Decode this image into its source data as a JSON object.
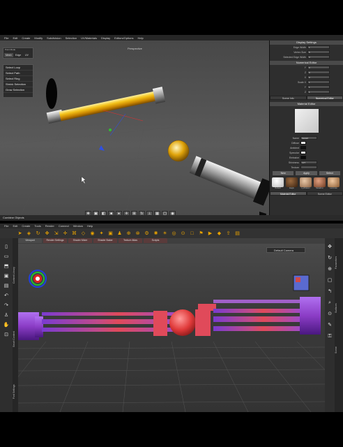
{
  "top_app": {
    "menu": [
      "File",
      "Edit",
      "Create",
      "Modify",
      "Subdivision",
      "Selection",
      "UV/Materials",
      "Display",
      "Editors/Options",
      "Help"
    ],
    "viewport_label": "Perspective",
    "selection_mode": {
      "title": "Point Mode",
      "buttons": [
        "Mesh",
        "Edge",
        "UV"
      ],
      "subtitle": "Surface View"
    },
    "selection_menu": [
      "Select Loop",
      "Select Path",
      "Select Ring",
      "Shrink Selection",
      "Grow Selection"
    ],
    "status": "Combine Objects",
    "display_settings": {
      "title": "Display Settings",
      "rows": [
        {
          "label": "Edge Width",
          "value": "1"
        },
        {
          "label": "Vertex Size",
          "value": "5"
        },
        {
          "label": "Selected Edge Width",
          "value": "3"
        }
      ]
    },
    "numerical_editor": {
      "title": "Numerical Editor",
      "rows": [
        {
          "label": "Y",
          "value": "0"
        },
        {
          "label": "Z",
          "value": "0"
        },
        {
          "label": "X",
          "value": "0"
        },
        {
          "label": "Scale X",
          "value": "1"
        },
        {
          "label": "Y",
          "value": "1"
        },
        {
          "label": "Z",
          "value": "1"
        }
      ],
      "tabs": [
        "Scene Info",
        "Numerical Editor"
      ]
    },
    "material_editor": {
      "title": "Material Editor",
      "name_label": "Name",
      "name_value": "Metal2",
      "properties": [
        {
          "label": "Diffuse",
          "color": "#f2f2f2"
        },
        {
          "label": "Ambient",
          "color": "#111111"
        },
        {
          "label": "Specular",
          "color": "#e0e0e0"
        },
        {
          "label": "Emissive",
          "color": "#0a0a0a"
        }
      ],
      "shininess_label": "Shininess",
      "shininess_value": "127",
      "texture_label": "Texture",
      "buttons": [
        "New",
        "Apply",
        "Select"
      ],
      "materials": [
        {
          "name": "Default",
          "color": "#f0f0f0"
        },
        {
          "name": "Eagle",
          "color": "#5a3a22"
        },
        {
          "name": "LynPattern",
          "color": "#c9a07a"
        },
        {
          "name": "Metal/Lio",
          "color": "#b57a52"
        },
        {
          "name": "Laminate",
          "color": "#d2a27a"
        }
      ],
      "tabs": [
        "Material Editor",
        "Scene Editor"
      ]
    }
  },
  "bottom_app": {
    "menu": [
      "File",
      "Edit",
      "Create",
      "Tools",
      "Render",
      "Connect",
      "Window",
      "Help"
    ],
    "tabs": [
      "Viewport",
      "Render Settings",
      "Shader Mixer",
      "Shader Baker",
      "Texture Atlas",
      "Scripts"
    ],
    "camera_label": "Default Camera",
    "left_tabs": [
      "Content Library",
      "Smart Content",
      "Post Settings"
    ],
    "right_tabs": [
      "Parameters",
      "Surfaces",
      "Scene"
    ]
  },
  "colors": {
    "gold": "#e8a800",
    "purple": "#8b3dc6",
    "red": "#e04a4a",
    "icon_orange": "#e8a200"
  }
}
